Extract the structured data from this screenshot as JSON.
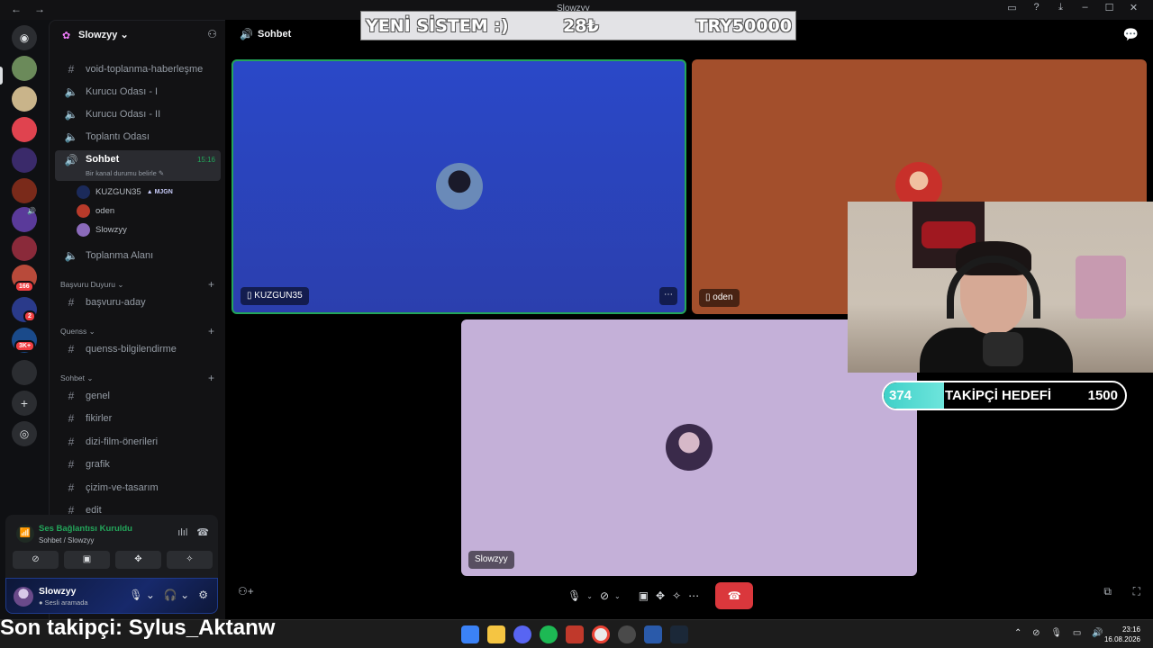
{
  "window": {
    "title": "Slowzyy"
  },
  "overlay": {
    "banner_left": "YENİ SİSTEM :)",
    "banner_mid": "28₺",
    "banner_right": "TRY50000",
    "goal_current": "374",
    "goal_label": "TAKİPÇİ HEDEFİ",
    "goal_target": "1500",
    "goal_progress": 0.249,
    "last_follower": "Son takipçi: Sylus_Aktanw"
  },
  "server": {
    "name": "Slowzyy"
  },
  "rail": {
    "badges": [
      "166",
      "2",
      "3K+"
    ]
  },
  "channels": {
    "top": [
      {
        "name": "void-toplanma-haberleşme",
        "type": "text"
      },
      {
        "name": "Kurucu Odası - I",
        "type": "voice"
      },
      {
        "name": "Kurucu Odası - II",
        "type": "voice"
      },
      {
        "name": "Toplantı Odası",
        "type": "voice"
      }
    ],
    "active": {
      "name": "Sohbet",
      "time": "15:16",
      "status": "Bir kanal durumu belirle"
    },
    "members": [
      {
        "name": "KUZGUN35",
        "role": "MJGN"
      },
      {
        "name": "oden",
        "role": ""
      },
      {
        "name": "Slowzyy",
        "role": ""
      }
    ],
    "after": {
      "name": "Toplanma Alanı"
    },
    "categories": [
      {
        "name": "Başvuru Duyuru",
        "channels": [
          "başvuru-aday"
        ]
      },
      {
        "name": "Quenss",
        "channels": [
          "quenss-bilgilendirme"
        ]
      },
      {
        "name": "Sohbet",
        "channels": [
          "genel",
          "fikirler",
          "dizi-film-önerileri",
          "grafik",
          "çizim-ve-tasarım",
          "edit"
        ]
      }
    ]
  },
  "voice_panel": {
    "title": "Ses Bağlantısı Kuruldu",
    "sub": "Sohbet / Slowzyy"
  },
  "user": {
    "name": "Slowzyy",
    "status": "Sesli aramada"
  },
  "main": {
    "title": "Sohbet",
    "tiles": [
      {
        "name": "KUZGUN35",
        "color": "#2c44b8"
      },
      {
        "name": "oden",
        "color": "#a34f2c"
      },
      {
        "name": "Slowzyy",
        "color": "#c4b0d8"
      }
    ]
  },
  "taskbar": {
    "time": "23:16",
    "date": "16.08.2026"
  },
  "colors": {
    "green": "#23a55a",
    "hangup": "#da373c",
    "blurple": "#5865f2"
  }
}
